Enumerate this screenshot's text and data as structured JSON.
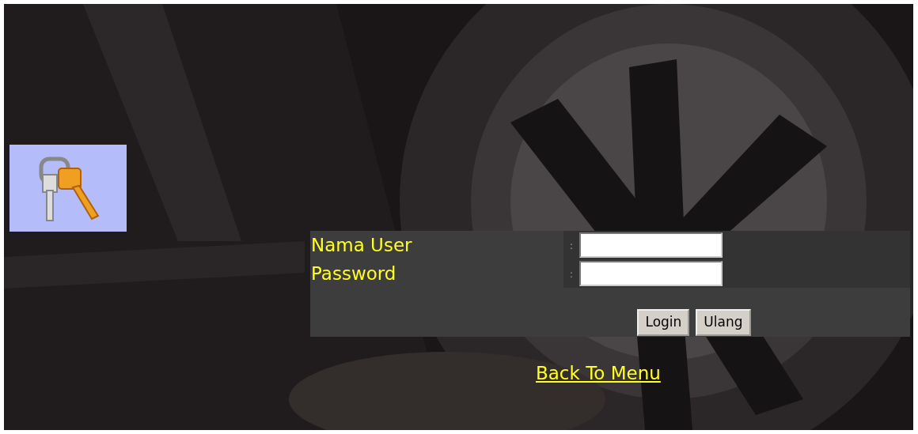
{
  "form": {
    "fields": [
      {
        "label": "Nama User",
        "separator": ":"
      },
      {
        "label": "Password",
        "separator": ":"
      }
    ],
    "buttons": [
      "Login",
      "Ulang"
    ]
  },
  "link": "Back To Menu"
}
